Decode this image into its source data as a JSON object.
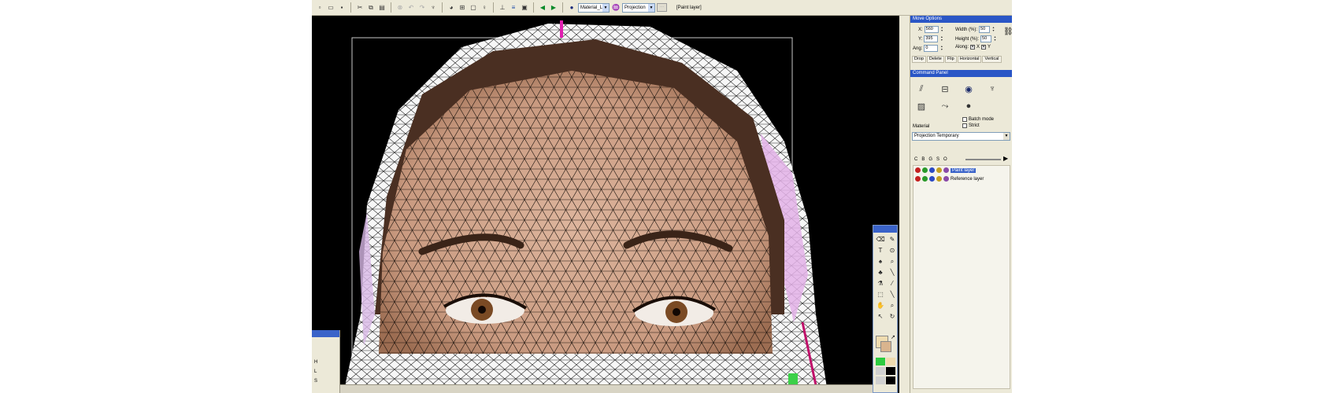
{
  "toolbar": {
    "material_combo": "Material_L",
    "projection_combo": "Projection",
    "layer_label": "[Paint layer]",
    "icons": [
      "new-icon",
      "open-icon",
      "save-icon",
      "cut-icon",
      "copy-icon",
      "paste-icon",
      "delete-icon",
      "undo-icon",
      "redo-icon",
      "sculpt-icon",
      "sphere-icon",
      "grid-icon",
      "bulb-icon",
      "snap-icon",
      "view-icon",
      "object-icon",
      "prev-icon",
      "next-icon",
      "material-icon",
      "projection-icon"
    ]
  },
  "move_options": {
    "title": "Move Options",
    "x_label": "X:",
    "x_value": "560",
    "y_label": "Y:",
    "y_value": "395",
    "width_label": "Width (%):",
    "width_value": "50",
    "height_label": "Height (%):",
    "height_value": "50",
    "ang_label": "Ang:",
    "ang_value": "0",
    "along_label": "Along:",
    "along_x": "X",
    "along_y": "Y",
    "buttons": [
      "Drop",
      "Delete",
      "Flip",
      "Horizontal",
      "Vertical"
    ]
  },
  "command_panel": {
    "title": "Command Panel",
    "batch_mode": "Batch mode",
    "strict": "Strict",
    "material_label": "Material",
    "material_value": "Projection Temporary",
    "channels": [
      "C",
      "B",
      "G",
      "S",
      "O"
    ],
    "layers": [
      {
        "name": "Paint layer",
        "selected": true
      },
      {
        "name": "Reference layer",
        "selected": false
      }
    ]
  },
  "left_panel": {
    "labels": [
      "H",
      "L",
      "S"
    ]
  },
  "colors": {
    "title_bar": "#2a56c6",
    "face_fill": "#cfa189",
    "foreground_swatch": "#efdcb0",
    "accent_green": "#2ecc40"
  }
}
